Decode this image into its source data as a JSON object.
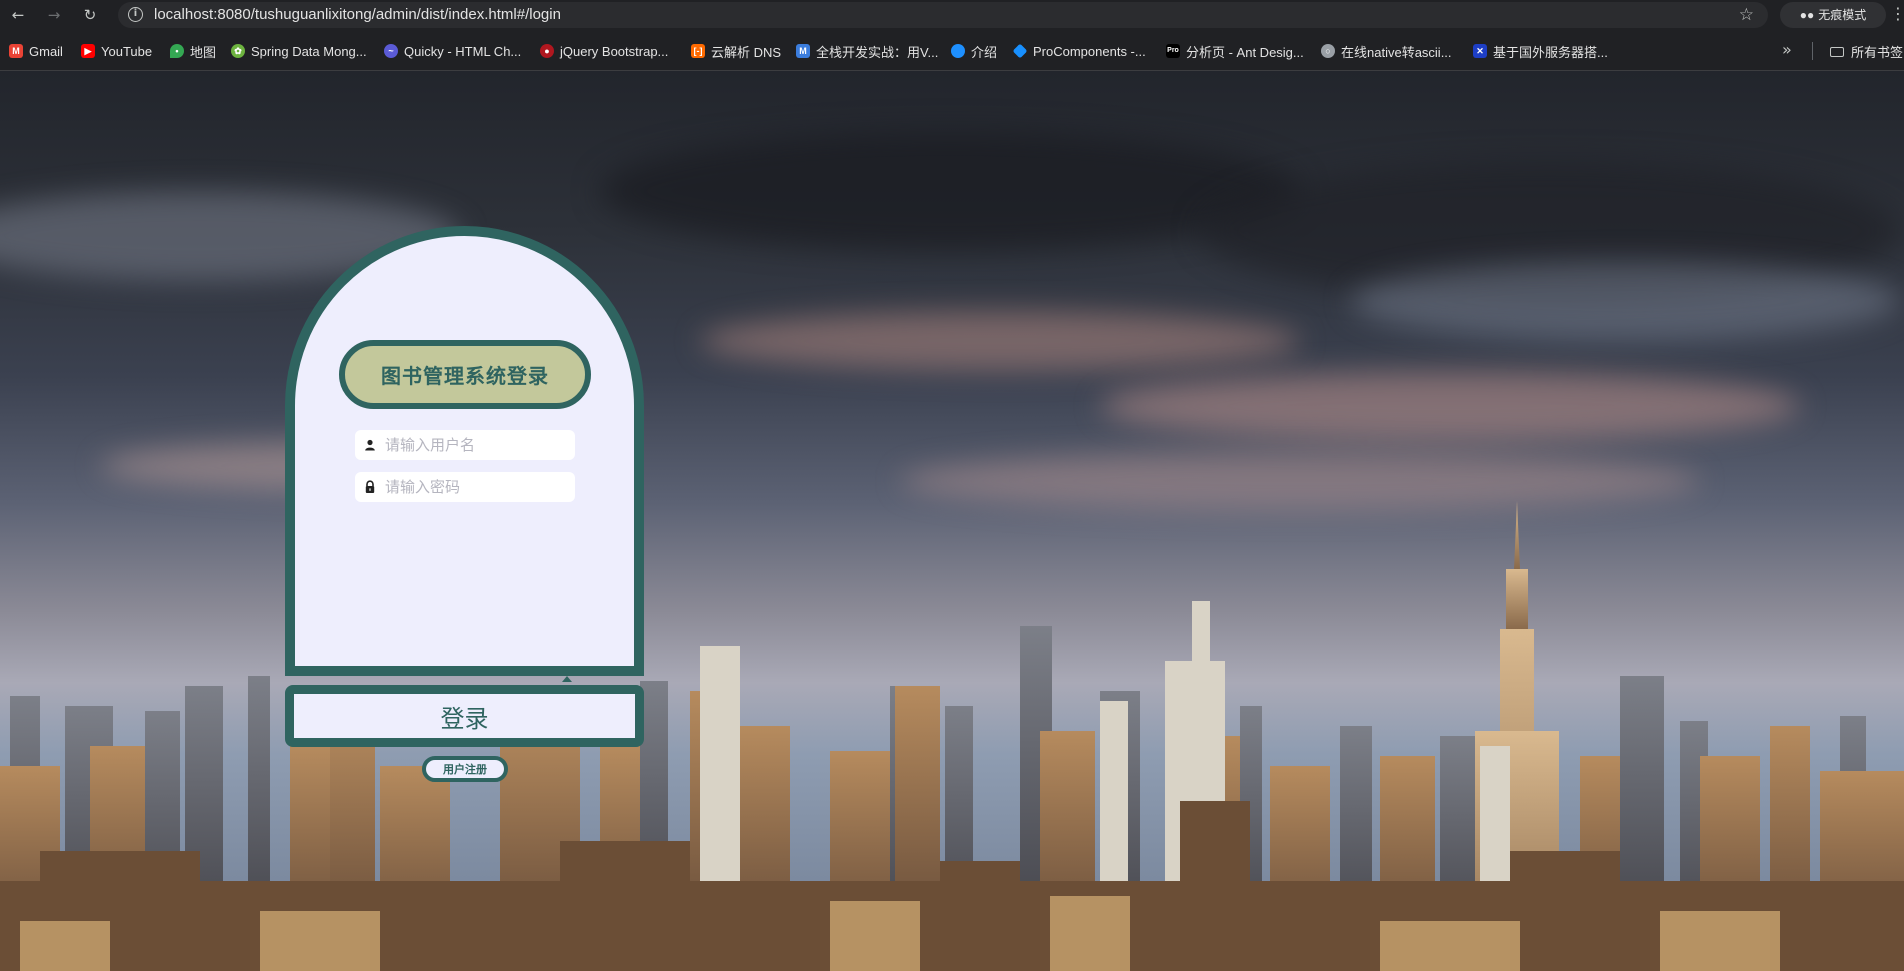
{
  "browser": {
    "url": "localhost:8080/tushuguanlixitong/admin/dist/index.html#/login",
    "incognito_label": "无痕模式",
    "bookmarks": [
      {
        "label": "Gmail",
        "icon": "gmail-icon",
        "color": "#ea4335"
      },
      {
        "label": "YouTube",
        "icon": "youtube-icon",
        "color": "#ff0000"
      },
      {
        "label": "地图",
        "icon": "maps-icon",
        "color": "#34a853"
      },
      {
        "label": "Spring Data Mong...",
        "icon": "spring-icon",
        "color": "#6db33f"
      },
      {
        "label": "Quicky - HTML Ch...",
        "icon": "quicky-icon",
        "color": "#5b5bd6"
      },
      {
        "label": "jQuery Bootstrap...",
        "icon": "jquery-icon",
        "color": "#b0171f"
      },
      {
        "label": "云解析 DNS",
        "icon": "aliyun-icon",
        "color": "#ff6a00"
      },
      {
        "label": "全栈开发实战：用V...",
        "icon": "m-icon",
        "color": "#3b7ddd"
      },
      {
        "label": "介绍",
        "icon": "intro-icon",
        "color": "#1e90ff"
      },
      {
        "label": "ProComponents -...",
        "icon": "antd-icon",
        "color": "#1890ff"
      },
      {
        "label": "分析页 - Ant Desig...",
        "icon": "pro-icon",
        "color": "#000000"
      },
      {
        "label": "在线native转ascii...",
        "icon": "globe-icon",
        "color": "#9aa0a6"
      },
      {
        "label": "基于国外服务器搭...",
        "icon": "flag-icon",
        "color": "#1d3ec5"
      }
    ],
    "all_bookmarks_label": "所有书签"
  },
  "login": {
    "title": "图书管理系统登录",
    "username_placeholder": "请输入用户名",
    "password_placeholder": "请输入密码",
    "login_button": "登录",
    "register_button": "用户注册"
  },
  "colors": {
    "accent": "#2f6460",
    "card_bg": "#eeeefd",
    "title_bg": "#c3c89b"
  }
}
